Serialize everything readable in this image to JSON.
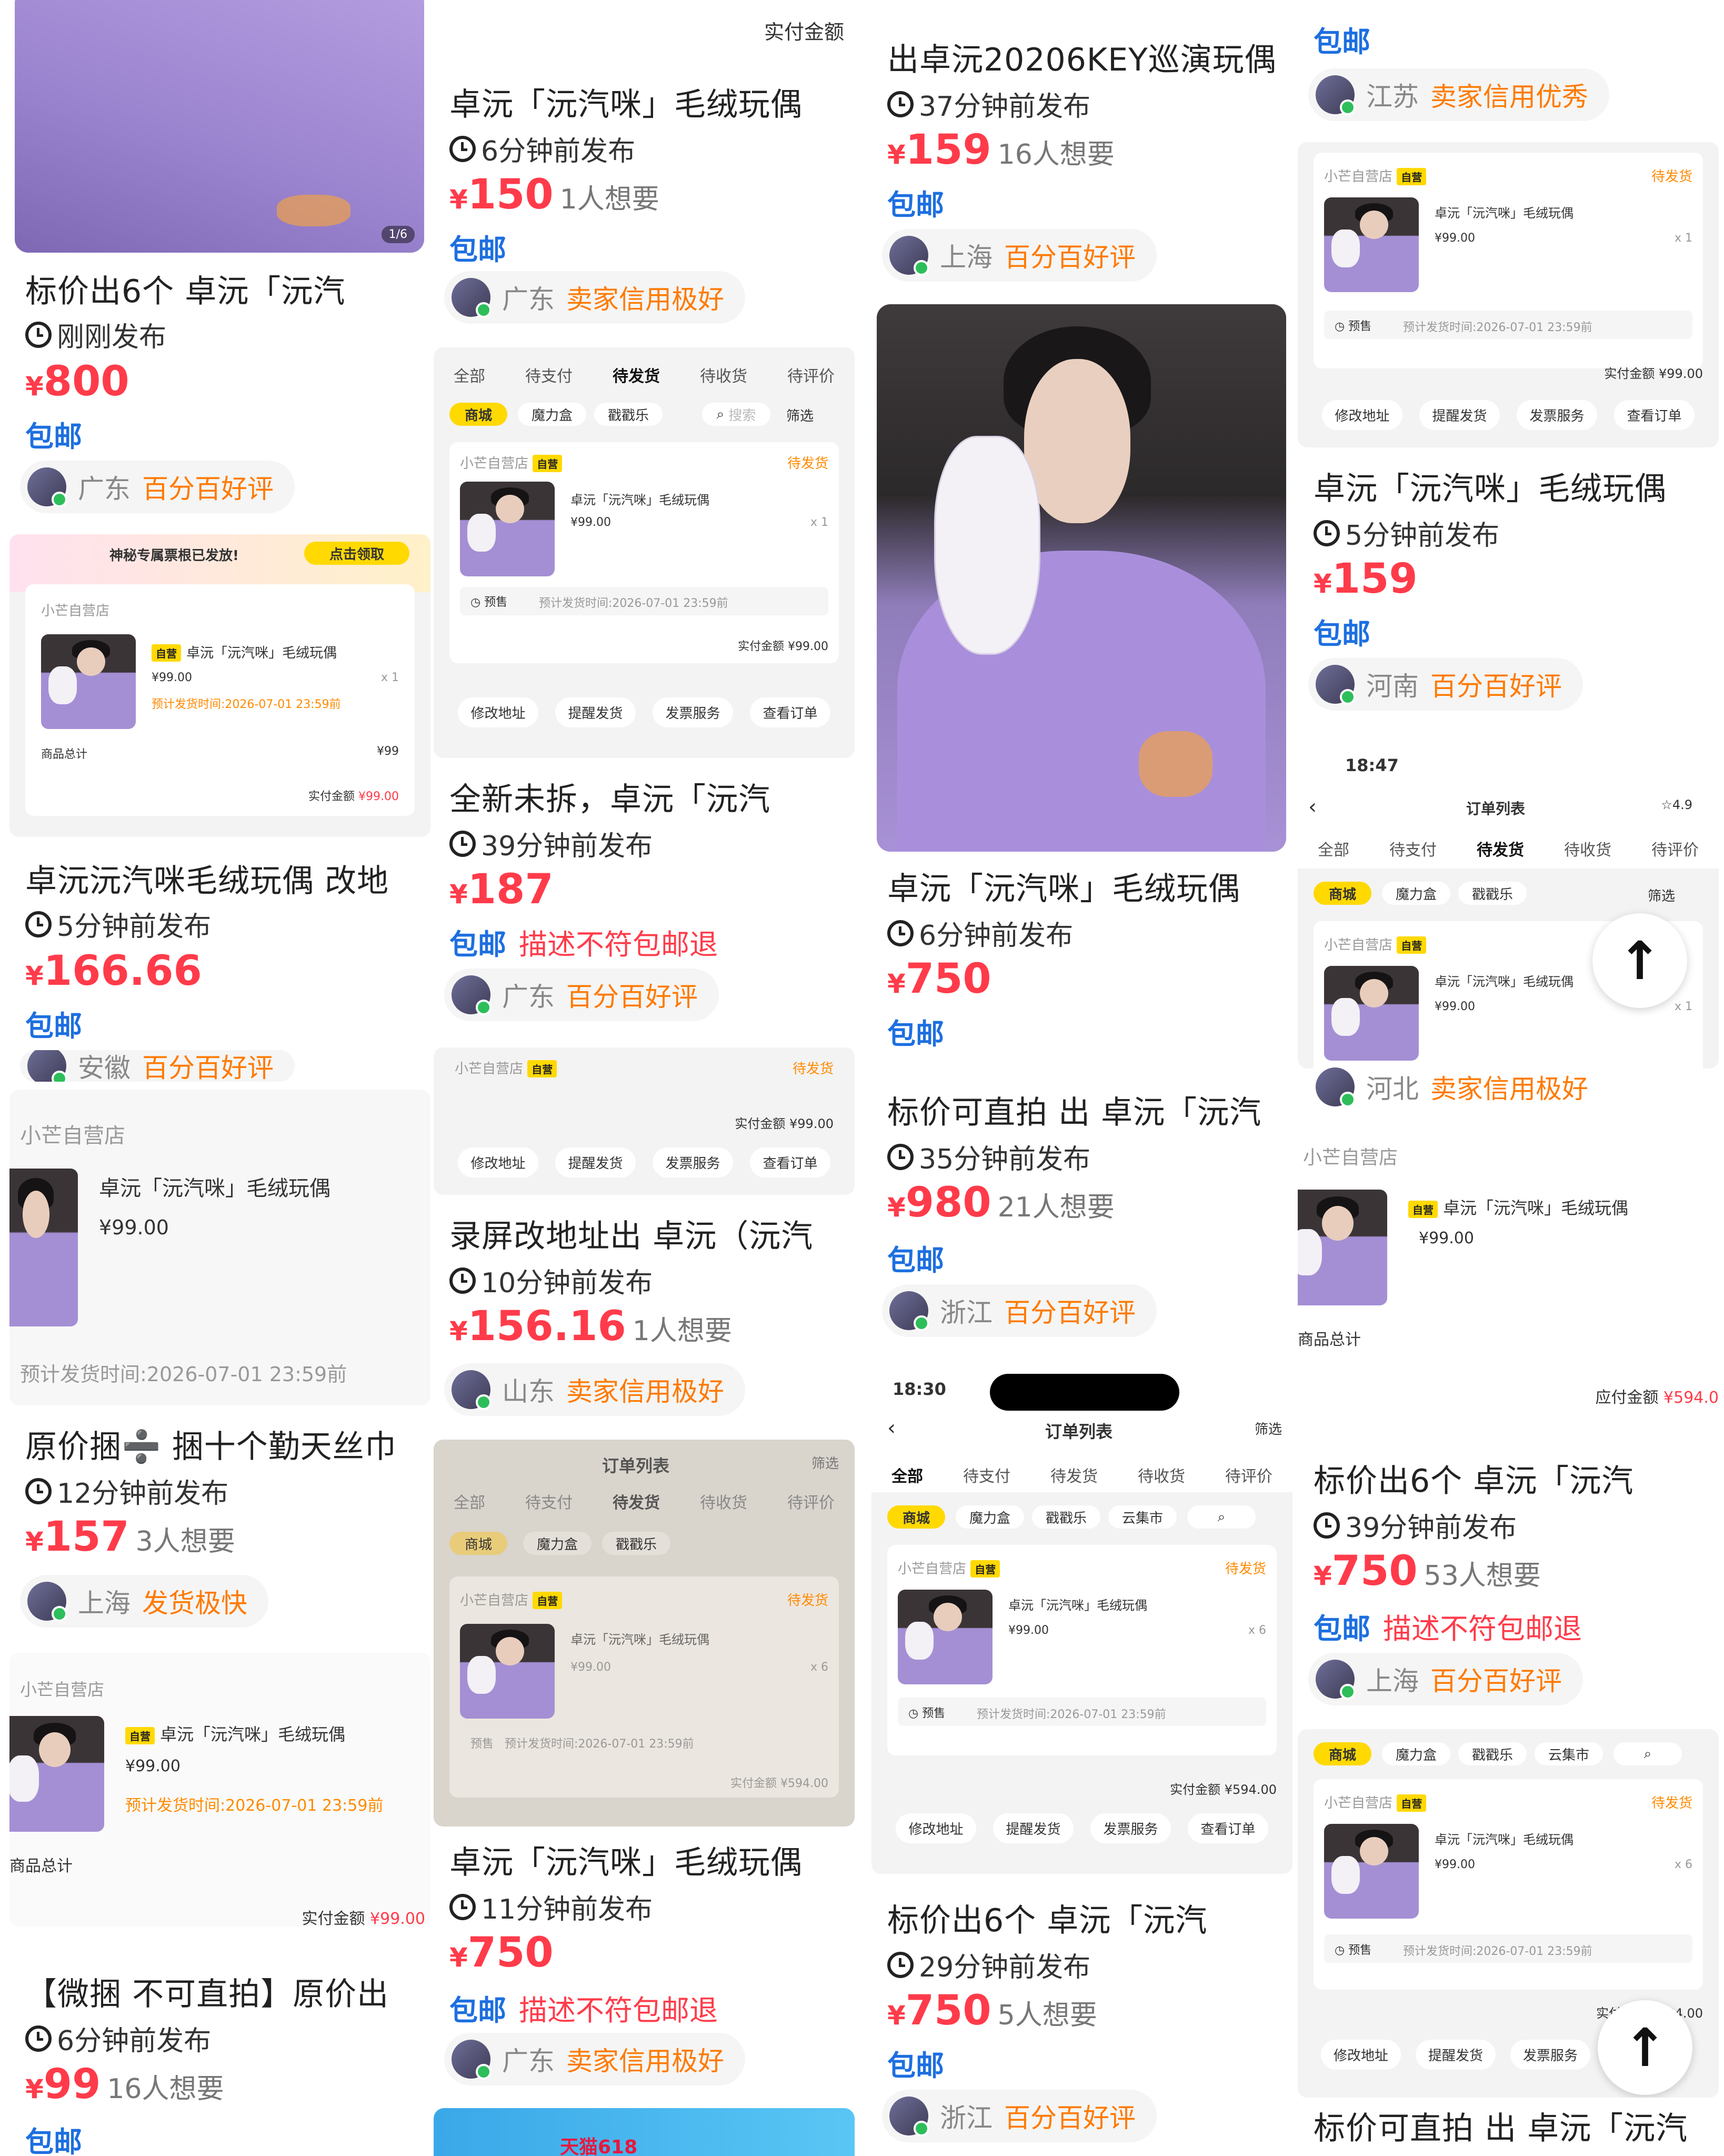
{
  "listings": [
    {
      "title": "标价出6个 卓沅「沅汽",
      "time": "刚刚发布",
      "price": "800",
      "want": "",
      "tags": [
        "包邮"
      ],
      "region": "广东",
      "credit": "百分百好评",
      "badge": "1/6"
    },
    {
      "title": "卓沅沅汽咪毛绒玩偶 改地",
      "time": "5分钟前发布",
      "price": "166.66",
      "want": "",
      "tags": [
        "包邮"
      ],
      "region": "安徽",
      "credit": "百分百好评"
    },
    {
      "title": "原价捆➗ 捆十个勤天丝巾",
      "time": "12分钟前发布",
      "price": "157",
      "want": "3人想要",
      "tags": [
        "包邮"
      ],
      "region": "上海",
      "credit": "发货极快"
    },
    {
      "title": "【微捆 不可直拍】原价出",
      "time": "6分钟前发布",
      "price": "99",
      "want": "16人想要",
      "tags": [
        "包邮"
      ]
    },
    {
      "title": "卓沅「沅汽咪」毛绒玩偶",
      "time": "6分钟前发布",
      "price": "150",
      "want": "1人想要",
      "tags": [
        "包邮"
      ],
      "region": "广东",
      "credit": "卖家信用极好"
    },
    {
      "title": "全新未拆，卓沅「沅汽",
      "time": "39分钟前发布",
      "price": "187",
      "want": "",
      "tags": [
        "包邮",
        "描述不符包邮退"
      ],
      "region": "广东",
      "credit": "百分百好评"
    },
    {
      "title": "录屏改地址出 卓沅（沅汽",
      "time": "10分钟前发布",
      "price": "156.16",
      "want": "1人想要",
      "tags": [],
      "region": "山东",
      "credit": "卖家信用极好"
    },
    {
      "title": "卓沅「沅汽咪」毛绒玩偶",
      "time": "11分钟前发布",
      "price": "750",
      "want": "",
      "tags": [
        "包邮",
        "描述不符包邮退"
      ],
      "region": "广东",
      "credit": "卖家信用极好"
    },
    {
      "title": "出卓沅20206KEY巡演玩偶",
      "time": "37分钟前发布",
      "price": "159",
      "want": "16人想要",
      "tags": [
        "包邮"
      ],
      "region": "上海",
      "credit": "百分百好评"
    },
    {
      "title": "卓沅「沅汽咪」毛绒玩偶",
      "time": "6分钟前发布",
      "price": "750",
      "want": "",
      "tags": [
        "包邮"
      ]
    },
    {
      "title": "标价可直拍 出 卓沅「沅汽",
      "time": "35分钟前发布",
      "price": "980",
      "want": "21人想要",
      "tags": [
        "包邮"
      ],
      "region": "浙江",
      "credit": "百分百好评"
    },
    {
      "title": "标价出6个 卓沅「沅汽",
      "time": "29分钟前发布",
      "price": "750",
      "want": "5人想要",
      "tags": [
        "包邮"
      ],
      "region": "浙江",
      "credit": "百分百好评"
    },
    {
      "title": "卓沅「沅汽咪」毛绒玩偶",
      "time": "5分钟前发布",
      "price": "159",
      "want": "",
      "tags": [
        "包邮"
      ],
      "region": "河南",
      "credit": "百分百好评"
    },
    {
      "title": "标价出6个 卓沅「沅汽",
      "time": "39分钟前发布",
      "price": "750",
      "want": "53人想要",
      "tags": [
        "包邮",
        "描述不符包邮退"
      ],
      "region": "上海",
      "credit": "百分百好评"
    },
    {
      "title": "标价可直拍 出 卓沅「沅汽",
      "time": "",
      "price": "",
      "want": "",
      "tags": []
    }
  ],
  "top_partial": {
    "region": "江苏",
    "credit": "卖家信用优秀",
    "tag": "包邮",
    "region2": "河北",
    "credit2": "卖家信用极好"
  },
  "order": {
    "shop": "小芒自营店",
    "self_tag": "自营",
    "product": "卓沅「沅汽咪」毛绒玩偶",
    "price": "¥99.00",
    "qty1": "x 1",
    "qty6": "x 6",
    "status": "待发货",
    "presale": "预售",
    "ship_time": "预计发货时间:2026-07-01 23:59前",
    "ship_time_orange": "预计发货时间:2026-07-01 23:59前",
    "paid_label": "实付金额",
    "paid99": "¥99.00",
    "paid594": "¥594.00",
    "due_label": "应付金额",
    "due594": "¥594.0",
    "goods_total": "商品总计",
    "goods_total_val": "¥99",
    "tabs": [
      "全部",
      "待支付",
      "待发货",
      "待收货",
      "待评价"
    ],
    "chips": [
      "商城",
      "魔力盒",
      "戳戳乐",
      "云集市"
    ],
    "search": "搜索",
    "filter": "筛选",
    "buttons": [
      "修改地址",
      "提醒发货",
      "发票服务",
      "查看订单"
    ],
    "list_title": "订单列表",
    "clock1": "18:47",
    "clock2": "18:30",
    "rating": "4.9",
    "banner": "神秘专属票根已发放!",
    "banner_btn": "点击领取",
    "paid_header": "实付金额"
  },
  "bottom_banner": "天猫618"
}
